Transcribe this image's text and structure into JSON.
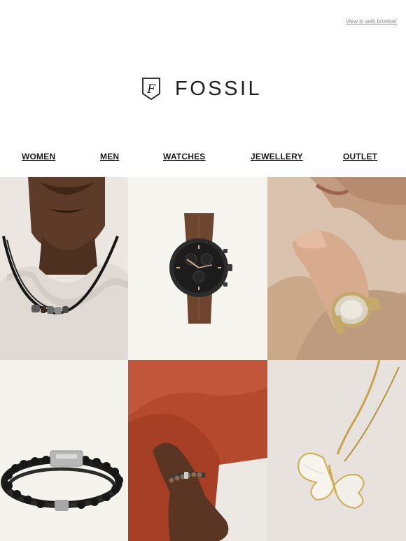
{
  "header": {
    "web_link": "View in web browser",
    "brand": "FOSSIL",
    "logo_monogram": "F"
  },
  "nav": {
    "items": [
      {
        "label": "WOMEN"
      },
      {
        "label": "MEN"
      },
      {
        "label": "WATCHES"
      },
      {
        "label": "JEWELLERY"
      },
      {
        "label": "OUTLET"
      }
    ]
  },
  "colors": {
    "background": "#ffffff",
    "text": "#1a1a1a",
    "muted_link": "#8a8a8a"
  },
  "product_grid": [
    {
      "icon": "mens-necklace-photo"
    },
    {
      "icon": "brown-leather-chronograph-watch-photo"
    },
    {
      "icon": "womens-gold-silver-watch-photo"
    },
    {
      "icon": "beaded-leather-bracelet-photo"
    },
    {
      "icon": "mens-beaded-bracelet-wrist-photo"
    },
    {
      "icon": "butterfly-pendant-necklace-photo"
    }
  ]
}
